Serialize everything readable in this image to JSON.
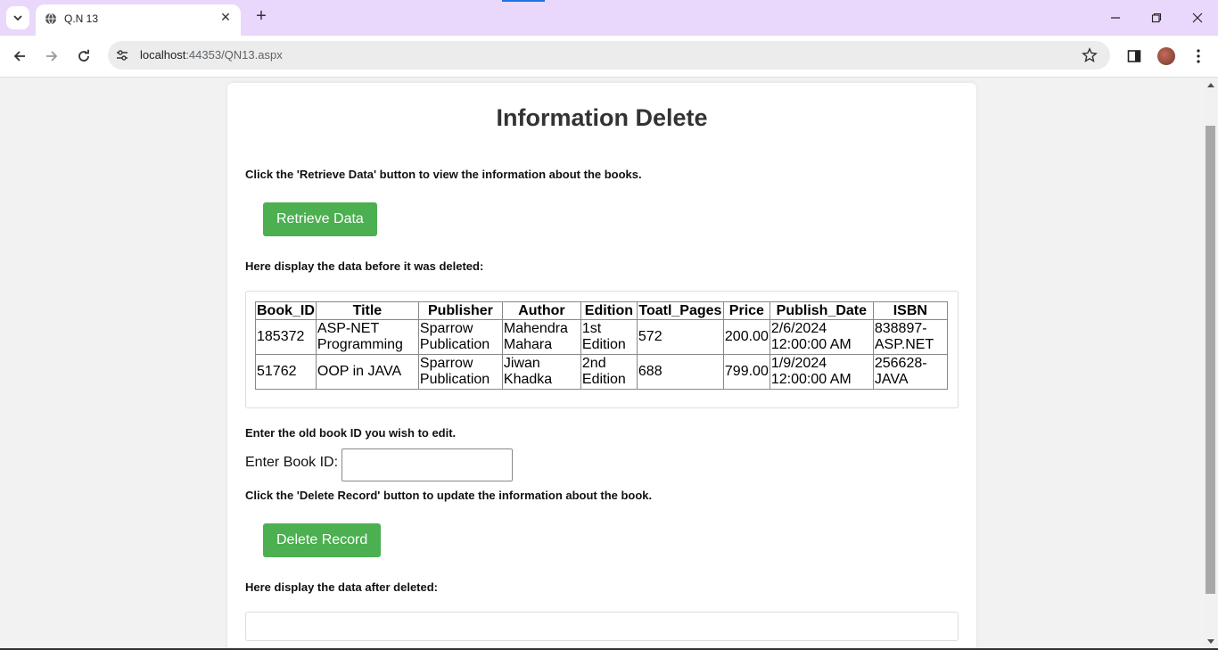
{
  "browser": {
    "tab_title": "Q.N 13",
    "url_host": "localhost",
    "url_path": ":44353/QN13.aspx"
  },
  "page": {
    "heading": "Information Delete",
    "instr_retrieve": "Click the 'Retrieve Data' button to view the information about the books.",
    "retrieve_button": "Retrieve Data",
    "instr_before": "Here display the data before it was deleted:",
    "table": {
      "headers": [
        "Book_ID",
        "Title",
        "Publisher",
        "Author",
        "Edition",
        "Toatl_Pages",
        "Price",
        "Publish_Date",
        "ISBN"
      ],
      "rows": [
        [
          "185372",
          "ASP-NET Programming",
          "Sparrow Publication",
          "Mahendra Mahara",
          "1st Edition",
          "572",
          "200.00",
          "2/6/2024 12:00:00 AM",
          "838897-ASP.NET"
        ],
        [
          "51762",
          "OOP in JAVA",
          "Sparrow Publication",
          "Jiwan Khadka",
          "2nd Edition",
          "688",
          "799.00",
          "1/9/2024 12:00:00 AM",
          "256628-JAVA"
        ]
      ]
    },
    "instr_id": "Enter the old book ID you wish to edit.",
    "book_id_label": "Enter Book ID:",
    "book_id_value": "",
    "instr_delete": "Click the 'Delete Record' button to update the information about the book.",
    "delete_button": "Delete Record",
    "instr_after": "Here display the data after deleted:"
  },
  "colors": {
    "button": "#4caf50",
    "tabbar": "#e9d8fb"
  }
}
